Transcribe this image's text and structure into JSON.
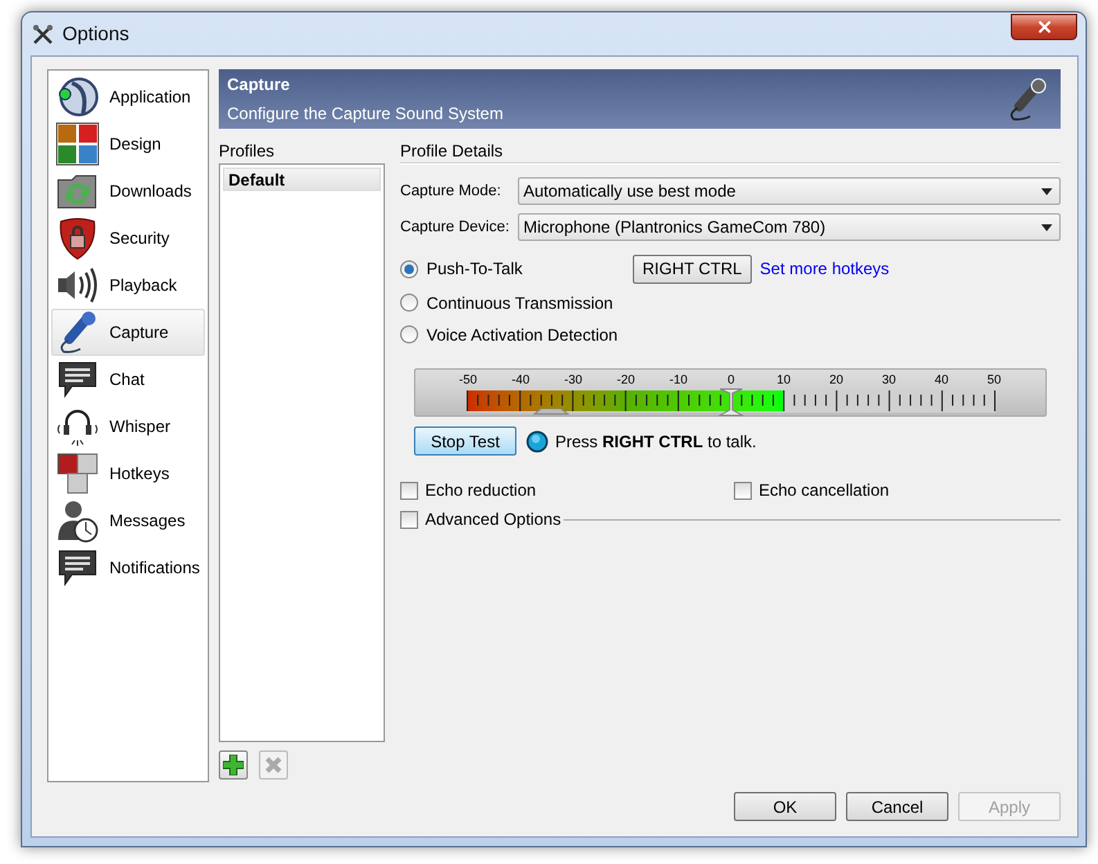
{
  "window": {
    "title": "Options"
  },
  "sidebar": {
    "items": [
      {
        "label": "Application",
        "selected": false
      },
      {
        "label": "Design",
        "selected": false
      },
      {
        "label": "Downloads",
        "selected": false
      },
      {
        "label": "Security",
        "selected": false
      },
      {
        "label": "Playback",
        "selected": false
      },
      {
        "label": "Capture",
        "selected": true
      },
      {
        "label": "Chat",
        "selected": false
      },
      {
        "label": "Whisper",
        "selected": false
      },
      {
        "label": "Hotkeys",
        "selected": false
      },
      {
        "label": "Messages",
        "selected": false
      },
      {
        "label": "Notifications",
        "selected": false
      }
    ]
  },
  "header": {
    "title": "Capture",
    "subtitle": "Configure the Capture Sound System"
  },
  "profiles": {
    "label": "Profiles",
    "items": [
      {
        "label": "Default",
        "selected": true
      }
    ]
  },
  "details": {
    "label": "Profile Details",
    "fields": [
      {
        "label": "Capture Mode:",
        "value": "Automatically use best mode"
      },
      {
        "label": "Capture Device:",
        "value": "Microphone (Plantronics GameCom 780)"
      }
    ],
    "modes": [
      {
        "label": "Push-To-Talk",
        "selected": true
      },
      {
        "label": "Continuous Transmission",
        "selected": false
      },
      {
        "label": "Voice Activation Detection",
        "selected": false
      }
    ],
    "hotkey": {
      "button": "RIGHT CTRL",
      "link": "Set more hotkeys"
    },
    "meter": {
      "scale": [
        "-50",
        "-40",
        "-30",
        "-20",
        "-10",
        "0",
        "10",
        "20",
        "30",
        "40",
        "50"
      ],
      "level": 0.6
    },
    "test_button": "Stop Test",
    "status": "Press **RIGHT CTRL** to talk.",
    "options": [
      {
        "label": "Echo reduction",
        "checked": false
      },
      {
        "label": "Echo cancellation",
        "checked": false
      }
    ],
    "advanced": {
      "label": "Advanced Options",
      "checked": false
    }
  },
  "buttons": [
    {
      "label": "OK",
      "disabled": false
    },
    {
      "label": "Cancel",
      "disabled": false
    },
    {
      "label": "Apply",
      "disabled": true
    }
  ]
}
